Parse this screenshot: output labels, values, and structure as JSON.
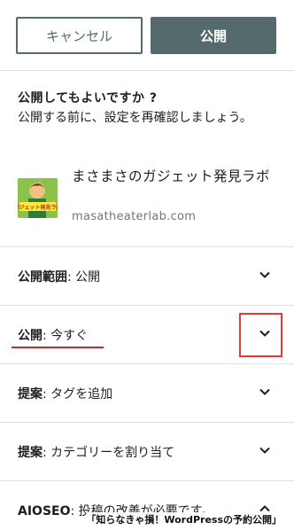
{
  "toolbar": {
    "cancel_label": "キャンセル",
    "publish_label": "公開"
  },
  "confirm": {
    "title": "公開してもよいですか ?",
    "description": "公開する前に、設定を再確認しましょう。"
  },
  "site": {
    "name": "まさまさのガジェット発見ラボ",
    "url": "masatheaterlab.com",
    "thumb_text": "ガジェット発見ラボ"
  },
  "rows": [
    {
      "key": "公開範囲",
      "value": "公開"
    },
    {
      "key": "公開",
      "value": "今すぐ"
    },
    {
      "key": "提案",
      "value": "タグを追加"
    },
    {
      "key": "提案",
      "value": "カテゴリーを割り当て"
    },
    {
      "key": "AIOSEO",
      "value": "投稿の改善が必要です。"
    }
  ],
  "caption": "「知らなきゃ損！WordPressの予約公開」",
  "colors": {
    "primary": "#546a6d",
    "annotation": "#e53935"
  },
  "icons": {
    "chevron": "chevron-down-icon",
    "chevron_up": "chevron-up-icon"
  }
}
